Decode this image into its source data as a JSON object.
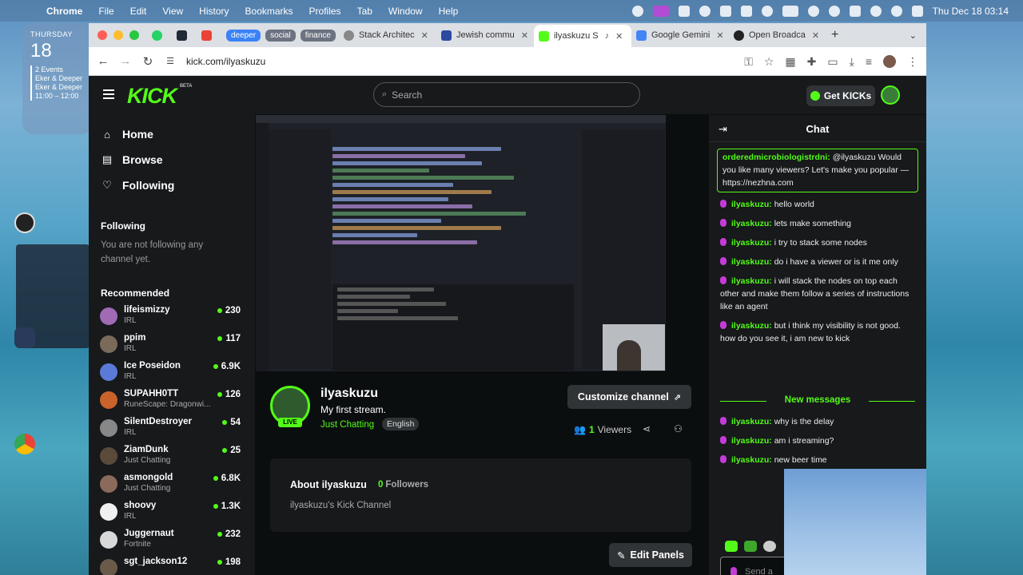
{
  "menubar": {
    "app": "Chrome",
    "items": [
      "File",
      "Edit",
      "View",
      "History",
      "Bookmarks",
      "Profiles",
      "Tab",
      "Window",
      "Help"
    ],
    "clock": "Thu Dec 18  03:14"
  },
  "desktop_widget": {
    "day": "THURSDAY",
    "date": "18",
    "events_count": "2 Events",
    "event1": "Eker & Deeper",
    "event2": "Eker & Deeper",
    "time": "11:00 – 12:00"
  },
  "browser": {
    "tab_groups": [
      {
        "label": "deeper",
        "color": "#3b82f6"
      },
      {
        "label": "social",
        "color": "#6b7280"
      },
      {
        "label": "finance",
        "color": "#6b7280"
      }
    ],
    "tabs": [
      {
        "title": "Stack Architec"
      },
      {
        "title": "Jewish commu"
      },
      {
        "title": "ilyaskuzu S"
      },
      {
        "title": "Google Gemini"
      },
      {
        "title": "Open Broadca"
      }
    ],
    "url": "kick.com/ilyaskuzu"
  },
  "kick": {
    "logo": "KICK",
    "beta": "BETA",
    "search_placeholder": "Search",
    "get_kicks": "Get KICKs",
    "nav": {
      "home": "Home",
      "browse": "Browse",
      "following": "Following"
    },
    "following_header": "Following",
    "following_note": "You are not following any channel yet.",
    "recommended_header": "Recommended",
    "recommended": [
      {
        "name": "lifeismizzy",
        "category": "IRL",
        "viewers": "230",
        "color": "#a06ab4"
      },
      {
        "name": "ppim",
        "category": "IRL",
        "viewers": "117",
        "color": "#7a6a5a"
      },
      {
        "name": "Ice Poseidon",
        "category": "IRL",
        "viewers": "6.9K",
        "color": "#5a7ad8"
      },
      {
        "name": "SUPAHH0TT",
        "category": "RuneScape: Dragonwi...",
        "viewers": "126",
        "color": "#c9632b"
      },
      {
        "name": "SilentDestroyer",
        "category": "IRL",
        "viewers": "54",
        "color": "#888888"
      },
      {
        "name": "ZiamDunk",
        "category": "Just Chatting",
        "viewers": "25",
        "color": "#5a4a3a"
      },
      {
        "name": "asmongold",
        "category": "Just Chatting",
        "viewers": "6.8K",
        "color": "#8a6a5a"
      },
      {
        "name": "shoovy",
        "category": "IRL",
        "viewers": "1.3K",
        "color": "#f0f0f0"
      },
      {
        "name": "Juggernaut",
        "category": "Fortnite",
        "viewers": "232",
        "color": "#d8d8d8"
      },
      {
        "name": "sgt_jackson12",
        "category": "",
        "viewers": "198",
        "color": "#6a5a4a"
      }
    ],
    "channel": {
      "name": "ilyaskuzu",
      "title": "My first stream.",
      "category": "Just Chatting",
      "language": "English",
      "live": "LIVE",
      "customize": "Customize channel",
      "viewers_count": "1",
      "viewers_label": "Viewers",
      "about_title": "About ilyaskuzu",
      "followers_count": "0",
      "followers_label": "Followers",
      "description": "ilyaskuzu's Kick Channel",
      "edit_panels": "Edit Panels"
    },
    "chat": {
      "title": "Chat",
      "pinned_user": "orderedmicrobiologistrdni:",
      "pinned_text": "@ilyaskuzu Would you like many viewers? Let's make you popular — https://nezhna.com",
      "messages": [
        {
          "user": "ilyaskuzu:",
          "text": "hello world"
        },
        {
          "user": "ilyaskuzu:",
          "text": "lets make something"
        },
        {
          "user": "ilyaskuzu:",
          "text": "i try to stack some nodes"
        },
        {
          "user": "ilyaskuzu:",
          "text": "do i have a viewer or is it me only"
        },
        {
          "user": "ilyaskuzu:",
          "text": "i will stack the nodes on top each other and make them follow a series of instructions like an agent"
        },
        {
          "user": "ilyaskuzu:",
          "text": "but i think my visibility is not good. how do you see it, i am new to kick"
        }
      ],
      "new_messages_label": "New messages",
      "new_messages": [
        {
          "user": "ilyaskuzu:",
          "text": "why is the delay"
        },
        {
          "user": "ilyaskuzu:",
          "text": "am i streaming?"
        },
        {
          "user": "ilyaskuzu:",
          "text": "new beer time"
        }
      ],
      "input_placeholder": "Send a"
    }
  },
  "colors": {
    "kick_green": "#53fc18",
    "page_bg": "#0b0e0f",
    "panel_bg": "#17191b",
    "mic": "#c53bd8"
  }
}
